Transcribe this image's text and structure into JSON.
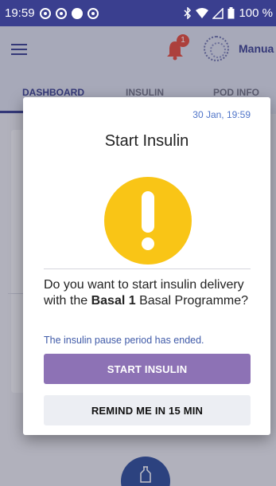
{
  "status_bar": {
    "time": "19:59",
    "battery": "100 %"
  },
  "header": {
    "mode_label": "Manua",
    "notification_count": "1"
  },
  "tabs": [
    {
      "label": "DASHBOARD"
    },
    {
      "label": "INSULIN"
    },
    {
      "label": "POD INFO"
    }
  ],
  "dialog": {
    "timestamp": "30 Jan, 19:59",
    "title": "Start Insulin",
    "message_pre": "Do you want to start insulin delivery with the ",
    "message_bold": "Basal 1",
    "message_post": " Basal Programme?",
    "sub_message": "The insulin pause period has ended.",
    "primary_button": "START INSULIN",
    "secondary_button": "REMIND ME IN 15 MIN"
  },
  "colors": {
    "status_bar": "#3a3f8f",
    "primary_button": "#8d72b5",
    "alert_icon": "#f9c516",
    "timestamp": "#4f74c8"
  },
  "icons": [
    "menu-icon",
    "bell-icon",
    "pod-status-icon",
    "alert-icon",
    "bolus-icon",
    "bluetooth-icon",
    "wifi-icon",
    "battery-icon"
  ]
}
